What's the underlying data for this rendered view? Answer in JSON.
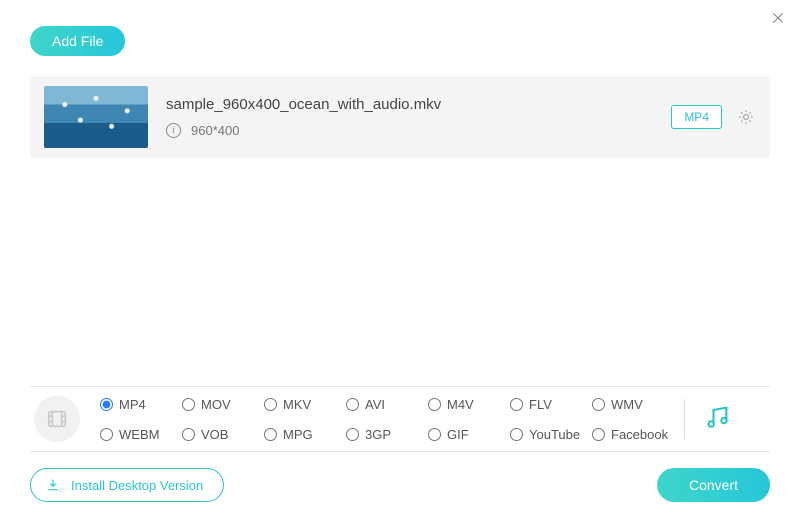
{
  "header": {
    "add_file_label": "Add File"
  },
  "file": {
    "name": "sample_960x400_ocean_with_audio.mkv",
    "dimensions": "960*400",
    "output_format": "MP4"
  },
  "formats": {
    "selected": "MP4",
    "options": [
      "MP4",
      "MOV",
      "MKV",
      "AVI",
      "M4V",
      "FLV",
      "WMV",
      "WEBM",
      "VOB",
      "MPG",
      "3GP",
      "GIF",
      "YouTube",
      "Facebook"
    ]
  },
  "footer": {
    "install_label": "Install Desktop Version",
    "convert_label": "Convert"
  }
}
